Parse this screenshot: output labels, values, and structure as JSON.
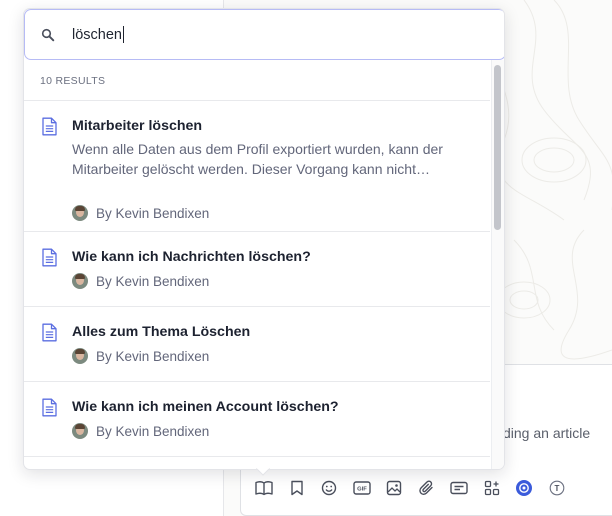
{
  "search": {
    "value": "löschen",
    "icon": "search-icon"
  },
  "results": {
    "count_label": "10 RESULTS",
    "items": [
      {
        "title": "Mitarbeiter löschen",
        "description": "Wenn alle Daten aus dem Profil exportiert wurden, kann der Mitarbeiter gelöscht werden. Dieser Vorgang kann nicht…",
        "author": "By Kevin Bendixen"
      },
      {
        "title": "Wie kann ich Nachrichten löschen?",
        "author": "By Kevin Bendixen"
      },
      {
        "title": "Alles zum Thema Löschen",
        "author": "By Kevin Bendixen"
      },
      {
        "title": "Wie kann ich meinen Account löschen?",
        "author": "By Kevin Bendixen"
      }
    ]
  },
  "composer": {
    "hint_fragment": "ding an article"
  },
  "toolbar": {
    "items": [
      "book-icon",
      "bookmark-icon",
      "emoji-icon",
      "gif-icon",
      "image-icon",
      "paperclip-icon",
      "card-icon",
      "apps-icon",
      "help-icon",
      "t-icon"
    ]
  },
  "colors": {
    "accent": "#3b5bdb",
    "doc_icon": "#5b6ee1",
    "search_border": "#b6bbf5"
  }
}
